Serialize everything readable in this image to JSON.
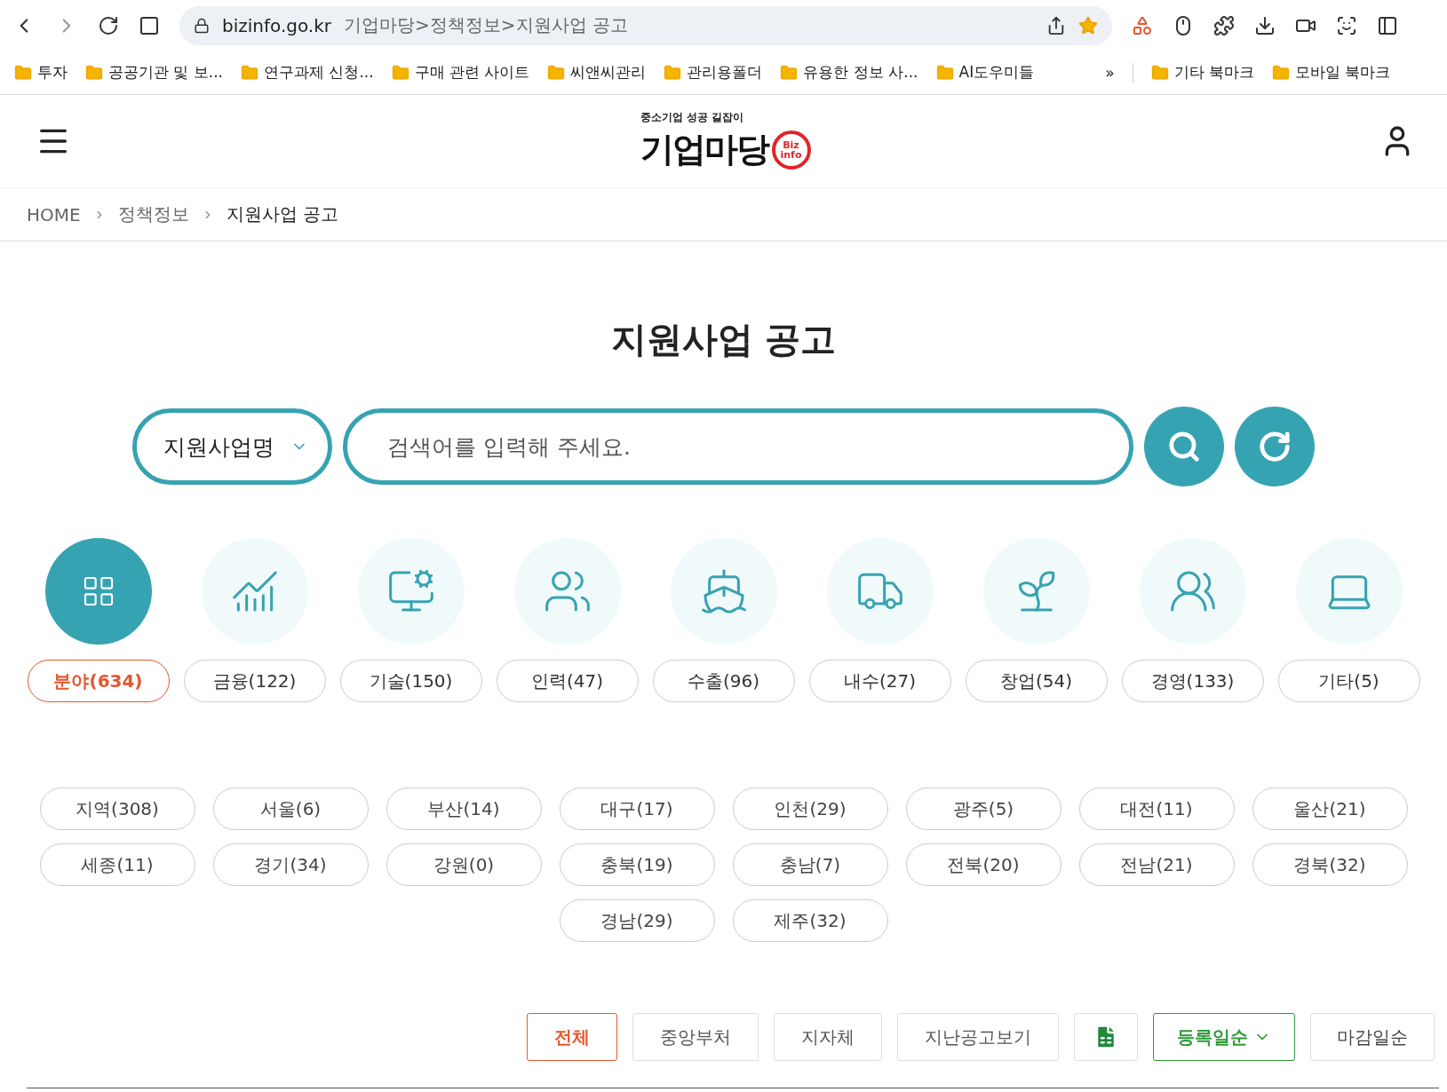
{
  "browser": {
    "url": {
      "domain": "bizinfo.go.kr",
      "path": "기업마당>정책정보>지원사업 공고"
    },
    "bookmarks": [
      "투자",
      "공공기관 및 보...",
      "연구과제 신청...",
      "구매 관련 사이트",
      "씨앤씨관리",
      "관리용폴더",
      "유용한 정보 사...",
      "AI도우미들"
    ],
    "overflow": "»",
    "other_bookmarks": [
      "기타 북마크",
      "모바일 북마크"
    ]
  },
  "logo": {
    "tagline": "중소기업 성공 길잡이",
    "name": "기업마당",
    "badge_top": "Biz",
    "badge_bottom": "info"
  },
  "breadcrumb": [
    "HOME",
    "정책정보",
    "지원사업 공고"
  ],
  "title": "지원사업 공고",
  "search": {
    "select": "지원사업명",
    "placeholder": "검색어를 입력해 주세요."
  },
  "categories": [
    {
      "label": "분야(634)",
      "kind": "all",
      "selected": true
    },
    {
      "label": "금융(122)",
      "kind": "finance",
      "selected": false
    },
    {
      "label": "기술(150)",
      "kind": "tech",
      "selected": false
    },
    {
      "label": "인력(47)",
      "kind": "people",
      "selected": false
    },
    {
      "label": "수출(96)",
      "kind": "export",
      "selected": false
    },
    {
      "label": "내수(27)",
      "kind": "domestic",
      "selected": false
    },
    {
      "label": "창업(54)",
      "kind": "startup",
      "selected": false
    },
    {
      "label": "경영(133)",
      "kind": "management",
      "selected": false
    },
    {
      "label": "기타(5)",
      "kind": "other",
      "selected": false
    }
  ],
  "regions": [
    "지역(308)",
    "서울(6)",
    "부산(14)",
    "대구(17)",
    "인천(29)",
    "광주(5)",
    "대전(11)",
    "울산(21)",
    "세종(11)",
    "경기(34)",
    "강원(0)",
    "충북(19)",
    "충남(7)",
    "전북(20)",
    "전남(21)",
    "경북(32)",
    "경남(29)",
    "제주(32)"
  ],
  "filters": [
    {
      "kind": "scope",
      "label": "전체",
      "selected": true
    },
    {
      "kind": "scope",
      "label": "중앙부처",
      "selected": false
    },
    {
      "kind": "scope",
      "label": "지자체",
      "selected": false
    },
    {
      "kind": "scope",
      "label": "지난공고보기",
      "selected": false
    },
    {
      "kind": "excel"
    },
    {
      "kind": "sort",
      "label": "등록일순",
      "selected": true
    },
    {
      "kind": "sort",
      "label": "마감일순",
      "selected": false
    }
  ]
}
